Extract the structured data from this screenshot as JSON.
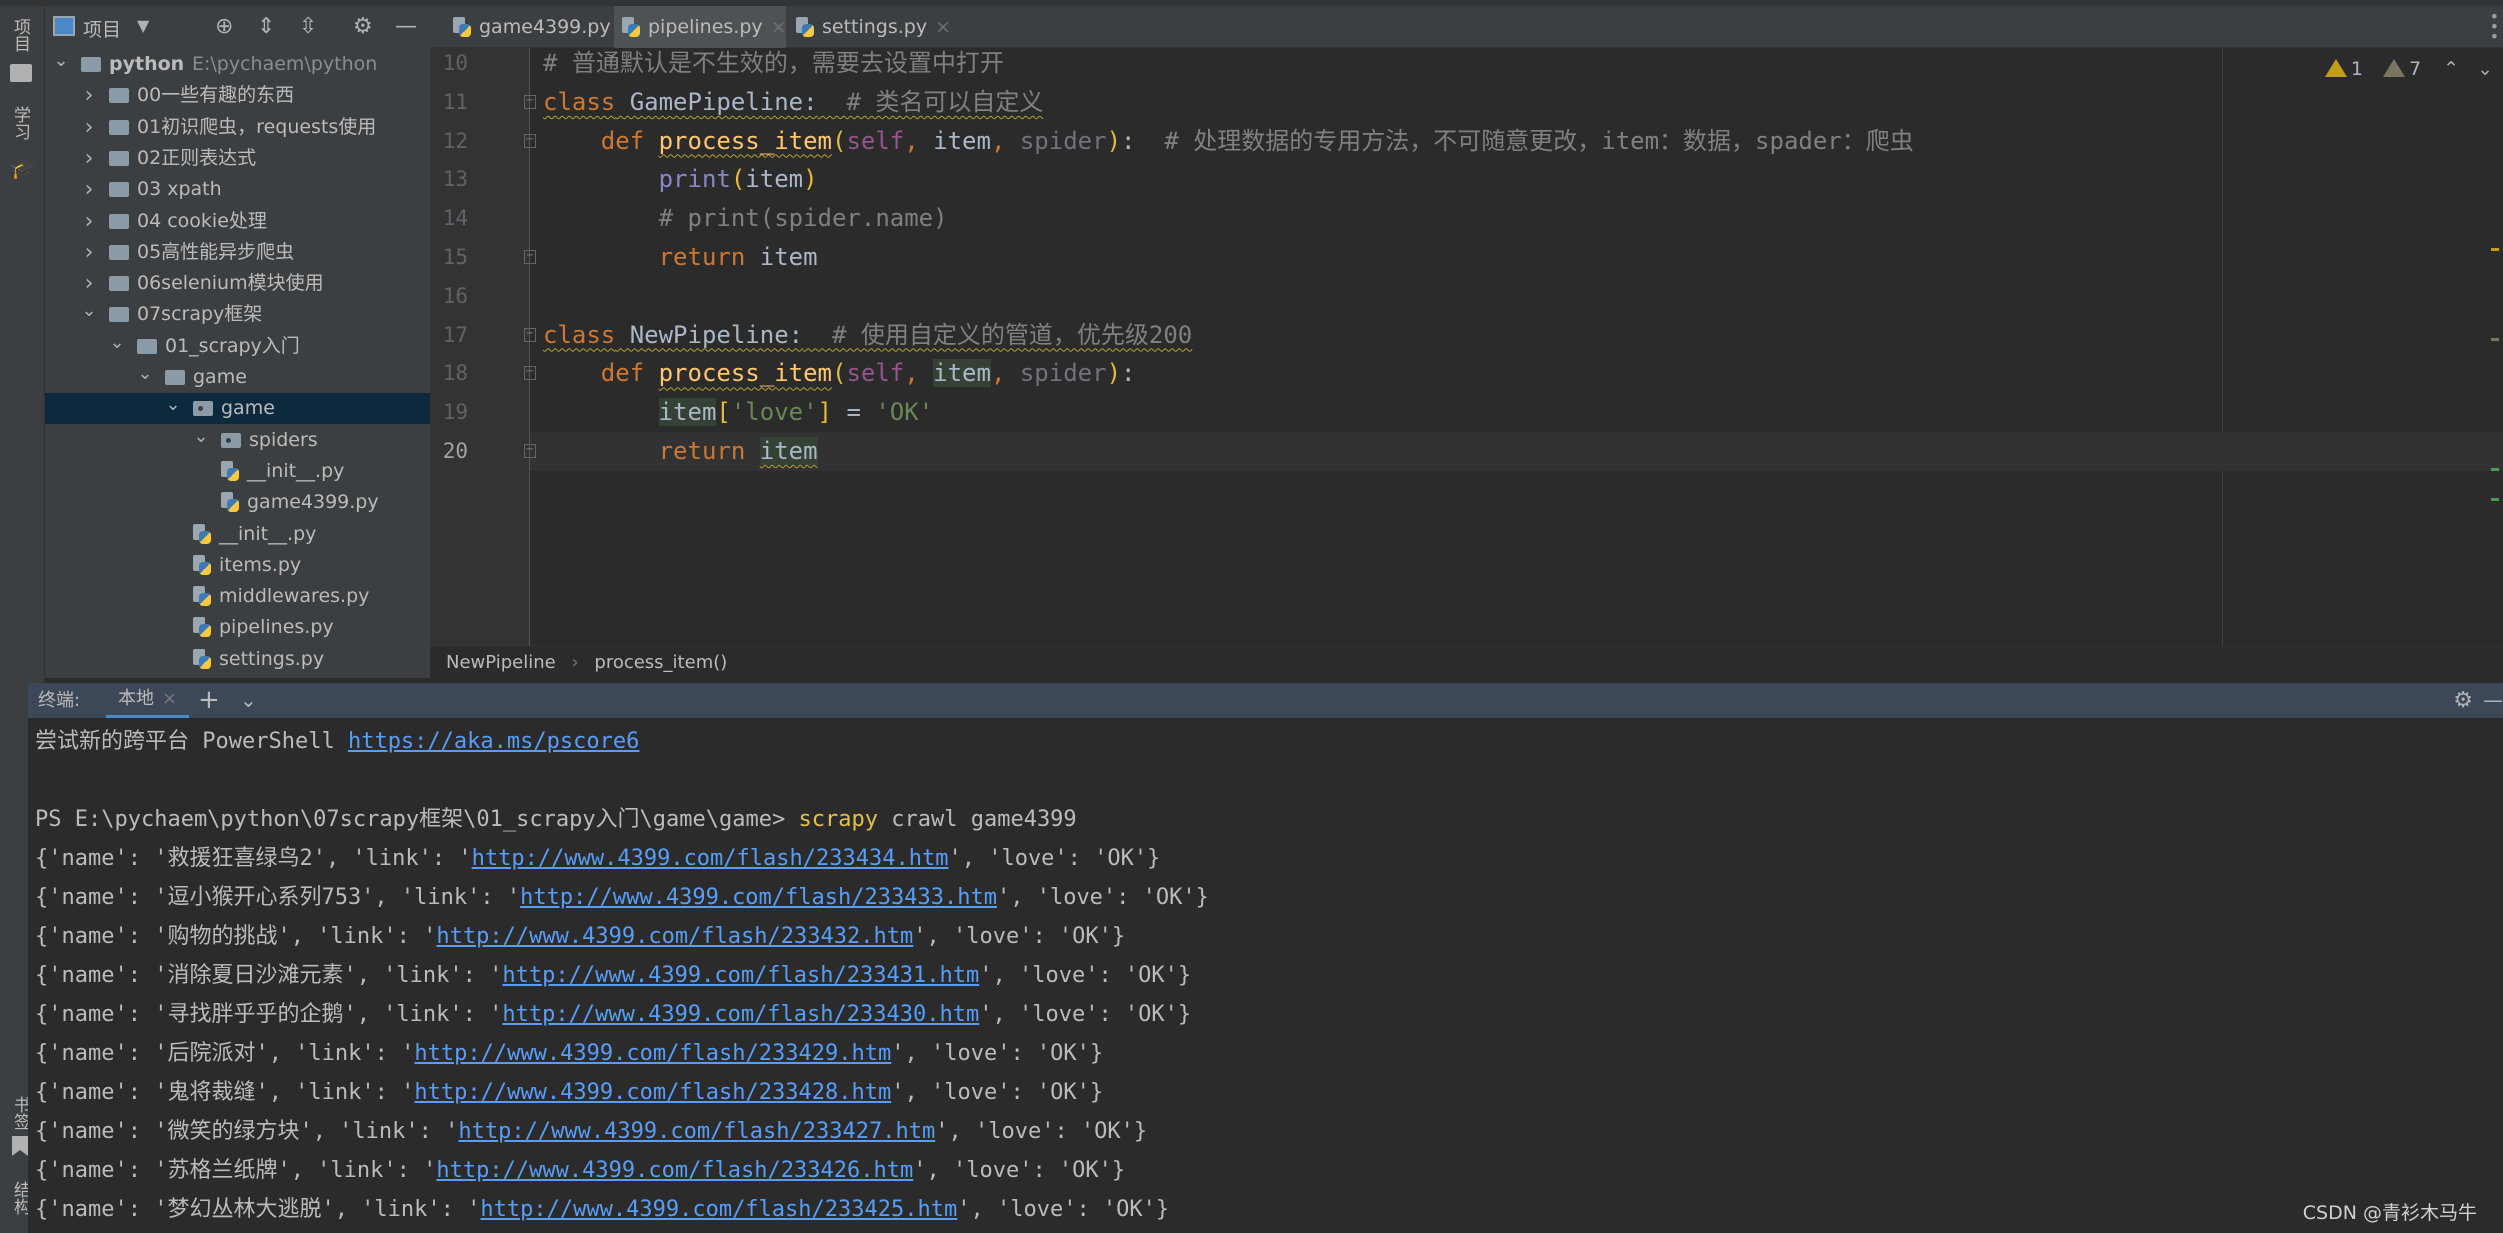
{
  "colors": {
    "editor_bg": "#2b2b2b",
    "sidebar_bg": "#3c3f41",
    "selection": "#0d293e",
    "link": "#589df6",
    "keyword": "#cc7832",
    "function": "#ffc66d",
    "comment": "#808080",
    "string": "#6a8759",
    "terminal_header": "#3c4757"
  },
  "left_strip": {
    "top": [
      "项目",
      "学习"
    ],
    "bottom": [
      "书签",
      "结构"
    ]
  },
  "sidebar": {
    "title": "项目",
    "tools": [
      "crosshair-icon",
      "expand-all-icon",
      "collapse-all-icon",
      "gear-icon",
      "minimize-icon"
    ],
    "tree": [
      {
        "label": "python",
        "path": "E:\\pychaem\\python",
        "level": 0,
        "type": "folder",
        "expanded": true,
        "bold": true
      },
      {
        "label": "00一些有趣的东西",
        "level": 1,
        "type": "folder",
        "expanded": false
      },
      {
        "label": "01初识爬虫，requests使用",
        "level": 1,
        "type": "folder",
        "expanded": false
      },
      {
        "label": "02正则表达式",
        "level": 1,
        "type": "folder",
        "expanded": false
      },
      {
        "label": "03 xpath",
        "level": 1,
        "type": "folder",
        "expanded": false
      },
      {
        "label": "04 cookie处理",
        "level": 1,
        "type": "folder",
        "expanded": false
      },
      {
        "label": "05高性能异步爬虫",
        "level": 1,
        "type": "folder",
        "expanded": false
      },
      {
        "label": "06selenium模块使用",
        "level": 1,
        "type": "folder",
        "expanded": false
      },
      {
        "label": "07scrapy框架",
        "level": 1,
        "type": "folder",
        "expanded": true
      },
      {
        "label": "01_scrapy入门",
        "level": 2,
        "type": "folder",
        "expanded": true
      },
      {
        "label": "game",
        "level": 3,
        "type": "folder",
        "expanded": true
      },
      {
        "label": "game",
        "level": 4,
        "type": "package",
        "expanded": true,
        "selected": true
      },
      {
        "label": "spiders",
        "level": 5,
        "type": "package",
        "expanded": true
      },
      {
        "label": "__init__.py",
        "level": 6,
        "type": "py"
      },
      {
        "label": "game4399.py",
        "level": 6,
        "type": "py"
      },
      {
        "label": "__init__.py",
        "level": 5,
        "type": "py"
      },
      {
        "label": "items.py",
        "level": 5,
        "type": "py"
      },
      {
        "label": "middlewares.py",
        "level": 5,
        "type": "py"
      },
      {
        "label": "pipelines.py",
        "level": 5,
        "type": "py"
      },
      {
        "label": "settings.py",
        "level": 5,
        "type": "py"
      }
    ]
  },
  "tabs": [
    {
      "label": "game4399.py",
      "active": false
    },
    {
      "label": "pipelines.py",
      "active": true
    },
    {
      "label": "settings.py",
      "active": false
    }
  ],
  "inspections": {
    "warnings": "1",
    "weak_warnings": "7"
  },
  "editor": {
    "current_line": 20,
    "lines": [
      {
        "n": "10",
        "tokens": [
          {
            "t": "# 普通默认是不生效的，需要去设置中打开",
            "c": "cm"
          }
        ]
      },
      {
        "n": "11",
        "fold": "start",
        "tokens": [
          {
            "t": "class",
            "c": "kw wave"
          },
          {
            "t": " GamePipeline:",
            "c": "wave"
          },
          {
            "t": "  # 类名可以自定义",
            "c": "cm wave"
          }
        ]
      },
      {
        "n": "12",
        "fold": "start",
        "tokens": [
          {
            "t": "    "
          },
          {
            "t": "def",
            "c": "kw"
          },
          {
            "t": " "
          },
          {
            "t": "process_item",
            "c": "fn wave"
          },
          {
            "t": "(",
            "c": "br"
          },
          {
            "t": "self",
            "c": "sf"
          },
          {
            "t": ", ",
            "c": "kw"
          },
          {
            "t": "item"
          },
          {
            "t": ", ",
            "c": "kw"
          },
          {
            "t": "spider",
            "c": "dp"
          },
          {
            "t": ")",
            "c": "br"
          },
          {
            "t": ":"
          },
          {
            "t": "  # 处理数据的专用方法，不可随意更改，item：数据，spader：爬虫",
            "c": "cm"
          }
        ]
      },
      {
        "n": "13",
        "tokens": [
          {
            "t": "        "
          },
          {
            "t": "print",
            "c": "bi"
          },
          {
            "t": "(",
            "c": "br"
          },
          {
            "t": "item"
          },
          {
            "t": ")",
            "c": "br"
          }
        ]
      },
      {
        "n": "14",
        "tokens": [
          {
            "t": "        "
          },
          {
            "t": "# print(spider.name)",
            "c": "cm"
          }
        ]
      },
      {
        "n": "15",
        "fold": "end",
        "tokens": [
          {
            "t": "        "
          },
          {
            "t": "return",
            "c": "kw"
          },
          {
            "t": " item"
          }
        ]
      },
      {
        "n": "16",
        "tokens": []
      },
      {
        "n": "17",
        "fold": "start",
        "tokens": [
          {
            "t": "class",
            "c": "kw wave"
          },
          {
            "t": " NewPipeline:",
            "c": "wave"
          },
          {
            "t": "  # 使用自定义的管道，优先级200",
            "c": "cm wave"
          }
        ]
      },
      {
        "n": "18",
        "fold": "start",
        "tokens": [
          {
            "t": "    "
          },
          {
            "t": "def",
            "c": "kw"
          },
          {
            "t": " "
          },
          {
            "t": "process_item",
            "c": "fn wave"
          },
          {
            "t": "(",
            "c": "br"
          },
          {
            "t": "self",
            "c": "sf"
          },
          {
            "t": ", ",
            "c": "kw"
          },
          {
            "t": "item",
            "c": "hl"
          },
          {
            "t": ", ",
            "c": "kw"
          },
          {
            "t": "spider",
            "c": "dp"
          },
          {
            "t": ")",
            "c": "br"
          },
          {
            "t": ":"
          }
        ]
      },
      {
        "n": "19",
        "tokens": [
          {
            "t": "        "
          },
          {
            "t": "item",
            "c": "hl"
          },
          {
            "t": "[",
            "c": "br"
          },
          {
            "t": "'love'",
            "c": "st"
          },
          {
            "t": "]",
            "c": "br"
          },
          {
            "t": " = "
          },
          {
            "t": "'OK'",
            "c": "st"
          }
        ]
      },
      {
        "n": "20",
        "fold": "end",
        "tokens": [
          {
            "t": "        "
          },
          {
            "t": "return",
            "c": "kw"
          },
          {
            "t": " "
          },
          {
            "t": "item",
            "c": "hl wave"
          }
        ]
      }
    ]
  },
  "breadcrumb": [
    "NewPipeline",
    "process_item()"
  ],
  "terminal": {
    "label": "终端:",
    "tab": "本地",
    "prompt_line": {
      "pre": "PS E:\\pychaem\\python\\07scrapy框架\\01_scrapy入门\\game\\game> ",
      "cmd": "scrapy",
      "rest": " crawl game4399"
    },
    "banner": {
      "text": "尝试新的跨平台 PowerShell ",
      "link": "https://aka.ms/pscore6"
    },
    "output": [
      {
        "pre": "{'name': '救援狂喜绿鸟2', 'link': '",
        "link": "http://www.4399.com/flash/233434.htm",
        "post": "', 'love': 'OK'}"
      },
      {
        "pre": "{'name': '逗小猴开心系列753', 'link': '",
        "link": "http://www.4399.com/flash/233433.htm",
        "post": "', 'love': 'OK'}"
      },
      {
        "pre": "{'name': '购物的挑战', 'link': '",
        "link": "http://www.4399.com/flash/233432.htm",
        "post": "', 'love': 'OK'}"
      },
      {
        "pre": "{'name': '消除夏日沙滩元素', 'link': '",
        "link": "http://www.4399.com/flash/233431.htm",
        "post": "', 'love': 'OK'}"
      },
      {
        "pre": "{'name': '寻找胖乎乎的企鹅', 'link': '",
        "link": "http://www.4399.com/flash/233430.htm",
        "post": "', 'love': 'OK'}"
      },
      {
        "pre": "{'name': '后院派对', 'link': '",
        "link": "http://www.4399.com/flash/233429.htm",
        "post": "', 'love': 'OK'}"
      },
      {
        "pre": "{'name': '鬼将裁缝', 'link': '",
        "link": "http://www.4399.com/flash/233428.htm",
        "post": "', 'love': 'OK'}"
      },
      {
        "pre": "{'name': '微笑的绿方块', 'link': '",
        "link": "http://www.4399.com/flash/233427.htm",
        "post": "', 'love': 'OK'}"
      },
      {
        "pre": "{'name': '苏格兰纸牌', 'link': '",
        "link": "http://www.4399.com/flash/233426.htm",
        "post": "', 'love': 'OK'}"
      },
      {
        "pre": "{'name': '梦幻丛林大逃脱', 'link': '",
        "link": "http://www.4399.com/flash/233425.htm",
        "post": "', 'love': 'OK'}"
      }
    ]
  },
  "watermark": "CSDN @青衫木马牛"
}
